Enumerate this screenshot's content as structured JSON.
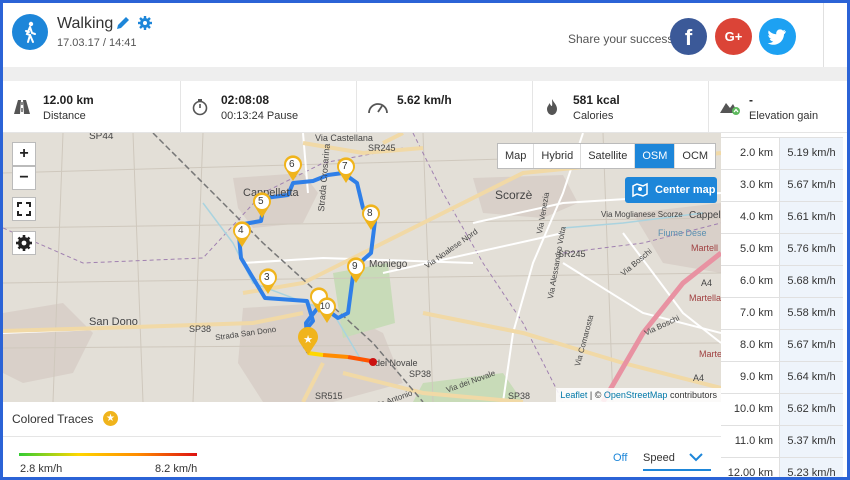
{
  "header": {
    "activity": "Walking",
    "datetime": "17.03.17 / 14:41",
    "share_text": "Share your success",
    "facebook": "f",
    "google": "G+"
  },
  "stats": [
    {
      "icon": "road-icon",
      "value": "12.00 km",
      "label": "Distance"
    },
    {
      "icon": "stopwatch-icon",
      "value": "02:08:08",
      "label": "00:13:24 Pause"
    },
    {
      "icon": "speedometer-icon",
      "value": "5.62 km/h",
      "label": ""
    },
    {
      "icon": "flame-icon",
      "value": "581 kcal",
      "label": "Calories"
    },
    {
      "icon": "elevation-icon",
      "value": "-",
      "label": "Elevation gain"
    }
  ],
  "map": {
    "types": [
      "Map",
      "Hybrid",
      "Satellite",
      "OSM",
      "OCM"
    ],
    "active_type": "OSM",
    "center_map": "Center map",
    "zoom_in": "+",
    "zoom_out": "−",
    "attribution_leaflet": "Leaflet",
    "attribution_sep": "| ©",
    "attribution_osm": "OpenStreetMap",
    "attribution_rest": "contributors",
    "labels": {
      "sp44": "SP44",
      "via_castellana": "Via Castellana",
      "sr245_top": "SR245",
      "cappelletta": "Cappelletta",
      "strada_crosarina": "Strada Crosarina",
      "scorze": "Scorzè",
      "via_moglianese": "Via Moglianese Scorze",
      "cappella": "Cappell",
      "fiume_dese": "Fiume Dese",
      "via_noalese_nord": "Via Noalese Nord",
      "via_venezia": "Via Venezia",
      "sr245": "SR245",
      "martella_top": "Martell",
      "moniego": "Moniego",
      "via_alessandro_volta": "Via Alessandro Volta",
      "via_boschi": "Via Boschi",
      "a4_top": "A4",
      "martella_bottom": "Martella",
      "san_dono": "San Dono",
      "sp38": "SP38",
      "strada_san_dono": "Strada San Dono",
      "via_boschi_2": "Via Boschi",
      "via_comarosta": "Via Comarosta",
      "sp38_2": "SP38",
      "sp38_3": "SP38",
      "via_dei_novale": "Via dei Novale",
      "dei_novale": "dei Novale",
      "a4": "A4",
      "sr515": "SR515",
      "via_antonio": "Via Antonio",
      "martella_2": "Martella"
    },
    "waypoints": [
      "3",
      "4",
      "5",
      "6",
      "7",
      "8",
      "9",
      "10"
    ]
  },
  "distance_table": [
    {
      "km": "2.0 km",
      "speed": "5.19 km/h"
    },
    {
      "km": "3.0 km",
      "speed": "5.67 km/h"
    },
    {
      "km": "4.0 km",
      "speed": "5.61 km/h"
    },
    {
      "km": "5.0 km",
      "speed": "5.76 km/h"
    },
    {
      "km": "6.0 km",
      "speed": "5.68 km/h"
    },
    {
      "km": "7.0 km",
      "speed": "5.58 km/h"
    },
    {
      "km": "8.0 km",
      "speed": "5.67 km/h"
    },
    {
      "km": "9.0 km",
      "speed": "5.64 km/h"
    },
    {
      "km": "10.0 km",
      "speed": "5.62 km/h"
    },
    {
      "km": "11.0 km",
      "speed": "5.37 km/h"
    },
    {
      "km": "12.00 km",
      "speed": "5.23 km/h"
    }
  ],
  "traces": {
    "title": "Colored Traces",
    "min_speed": "2.8 km/h",
    "max_speed": "8.2 km/h",
    "off": "Off",
    "mode": "Speed"
  },
  "colors": {
    "accent": "#1d86d9",
    "route": "#2f7fe8",
    "frame": "#2b63d6"
  }
}
